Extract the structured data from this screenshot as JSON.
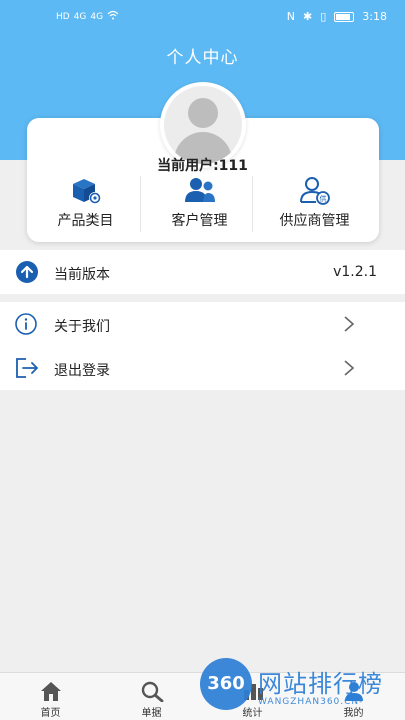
{
  "status_bar": {
    "left_icons": [
      "HD",
      "4G",
      "4G",
      "wifi-icon"
    ],
    "right_icons": [
      "nfc-icon",
      "bluetooth-icon",
      "vibrate-icon",
      "battery-icon"
    ],
    "time": "3:18"
  },
  "header": {
    "title": "个人中心",
    "background": "#5db9f3"
  },
  "profile": {
    "user_label": "当前用户:111",
    "avatar": "user-avatar-placeholder"
  },
  "quick_actions": [
    {
      "label": "产品类目",
      "icon": "product-box-icon"
    },
    {
      "label": "客户管理",
      "icon": "customers-icon"
    },
    {
      "label": "供应商管理",
      "icon": "supplier-icon"
    }
  ],
  "version": {
    "label": "当前版本",
    "value": "v1.2.1",
    "icon": "upload-arrow-icon"
  },
  "menu": [
    {
      "label": "关于我们",
      "icon": "info-icon"
    },
    {
      "label": "退出登录",
      "icon": "logout-icon"
    }
  ],
  "tabs": [
    {
      "label": "首页",
      "icon": "home-icon"
    },
    {
      "label": "单据",
      "icon": "search-icon"
    },
    {
      "label": "统计",
      "icon": "stats-icon"
    },
    {
      "label": "我的",
      "icon": "profile-icon"
    }
  ],
  "watermark": {
    "badge": "360",
    "title": "网站排行榜",
    "subtitle": "WANGZHAN360.CN-"
  },
  "colors": {
    "accent": "#5db9f3",
    "icon_blue": "#1b5fb0"
  }
}
